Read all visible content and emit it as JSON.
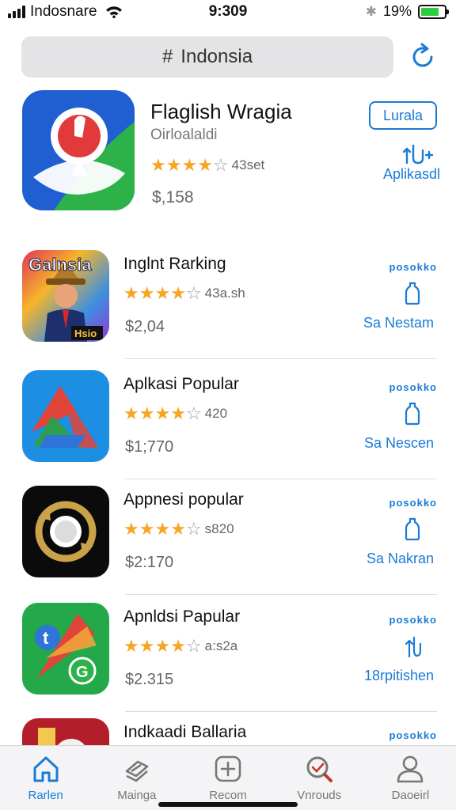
{
  "status_bar": {
    "carrier": "Indosnare",
    "time": "9:309",
    "battery_percent": "19%",
    "battery_level": 0.8
  },
  "search": {
    "hash": "#",
    "text": "Indonsia"
  },
  "featured": {
    "title": "Flaglish Wragia",
    "subtitle": "Oirloalaldi",
    "rating_filled": 4,
    "rating_count": "43set",
    "price": "$,158",
    "button_label": "Lurala",
    "action_label": "Aplikasdl"
  },
  "apps": [
    {
      "title": "Inglnt Rarking",
      "rating_filled": 4,
      "rating_count": "43a.sh",
      "price": "$2,04",
      "top_label": "posokko",
      "action_label": "Sa Nestam",
      "icon_text": "Galnsia",
      "icon_badge": "Hsio"
    },
    {
      "title": "Aplkasi Popular",
      "rating_filled": 4,
      "rating_count": "420",
      "price": "$1;770",
      "top_label": "posokko",
      "action_label": "Sa Nescen"
    },
    {
      "title": "Appnesi popular",
      "rating_filled": 4,
      "rating_count": "s820",
      "price": "$2:170",
      "top_label": "posokko",
      "action_label": "Sa Nakran"
    },
    {
      "title": "Apnldsi Papular",
      "rating_filled": 4,
      "rating_count": "a:s2a",
      "price": "$2.315",
      "top_label": "posokko",
      "action_label": "18rpitishen"
    },
    {
      "title": "Indkaadi Ballaria",
      "top_label": "posokko"
    }
  ],
  "tabs": [
    {
      "label": "Rarlen",
      "icon": "home-icon",
      "active": true
    },
    {
      "label": "Mainga",
      "icon": "layers-icon",
      "active": false
    },
    {
      "label": "Recom",
      "icon": "plus-square-icon",
      "active": false
    },
    {
      "label": "Vnrouds",
      "icon": "search-icon",
      "active": false
    },
    {
      "label": "Daoeirl",
      "icon": "person-icon",
      "active": false
    }
  ],
  "colors": {
    "accent": "#1a7bd6",
    "star": "#f5a623",
    "battery": "#2ecc40"
  }
}
